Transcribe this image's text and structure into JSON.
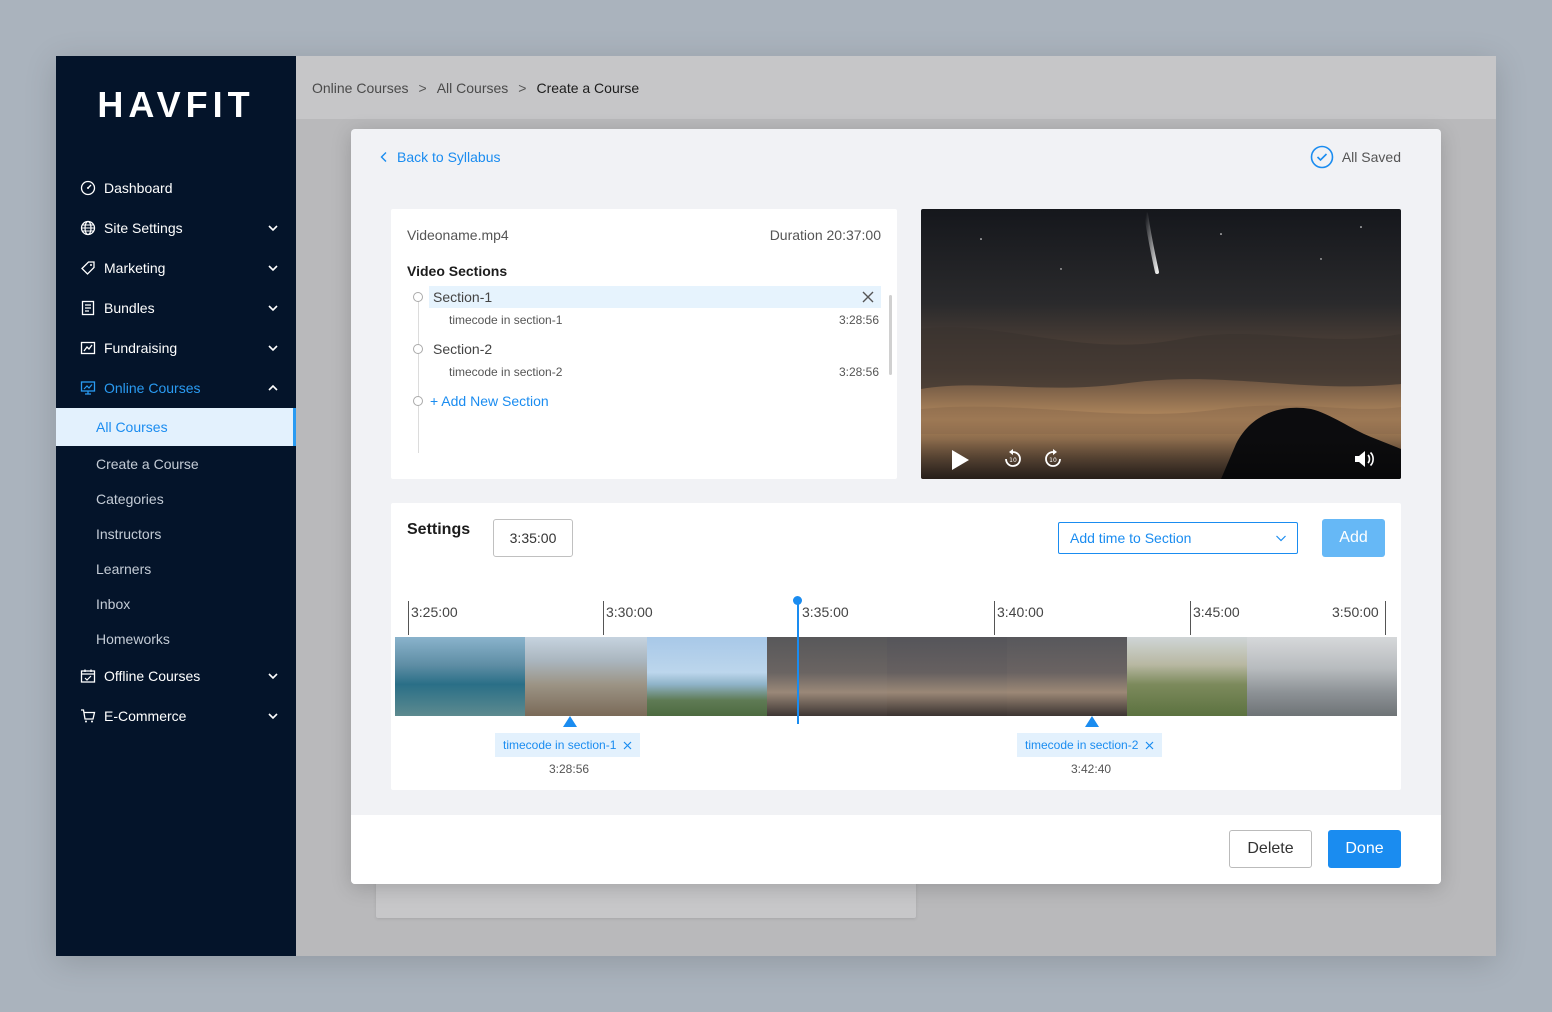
{
  "app": {
    "logo": "HAVFIT"
  },
  "sidebar": {
    "items": [
      {
        "label": "Dashboard",
        "icon": "dashboard-icon",
        "has_chevron": false
      },
      {
        "label": "Site Settings",
        "icon": "globe-icon",
        "has_chevron": true
      },
      {
        "label": "Marketing",
        "icon": "tag-icon",
        "has_chevron": true
      },
      {
        "label": "Bundles",
        "icon": "bundles-icon",
        "has_chevron": true
      },
      {
        "label": "Fundraising",
        "icon": "fundraising-icon",
        "has_chevron": true
      },
      {
        "label": "Online Courses",
        "icon": "presentation-icon",
        "has_chevron": true,
        "active": true
      }
    ],
    "online_courses_sub": [
      {
        "label": "All Courses",
        "selected": true
      },
      {
        "label": "Create a Course"
      },
      {
        "label": "Categories"
      },
      {
        "label": "Instructors"
      },
      {
        "label": "Learners"
      },
      {
        "label": "Inbox"
      },
      {
        "label": "Homeworks"
      }
    ],
    "items_after": [
      {
        "label": "Offline Courses",
        "icon": "calendar-icon",
        "has_chevron": true
      },
      {
        "label": "E-Commerce",
        "icon": "cart-icon",
        "has_chevron": true
      }
    ]
  },
  "breadcrumb": {
    "items": [
      "Online Courses",
      "All Courses",
      "Create a Course"
    ],
    "separator": ">"
  },
  "modal": {
    "back_label": "Back to Syllabus",
    "saved_label": "All Saved",
    "file": {
      "name": "Videoname.mp4",
      "duration": "Duration 20:37:00"
    },
    "video_sections_title": "Video Sections",
    "sections": [
      {
        "name": "Section-1",
        "timecode_label": "timecode in section-1",
        "timecode": "3:28:56"
      },
      {
        "name": "Section-2",
        "timecode_label": "timecode in section-2",
        "timecode": "3:28:56"
      }
    ],
    "add_section_label": "+ Add New Section",
    "settings": {
      "title": "Settings",
      "time_value": "3:35:00",
      "select_placeholder": "Add time to Section",
      "add_label": "Add"
    },
    "timeline": {
      "ticks": [
        "3:25:00",
        "3:30:00",
        "3:35:00",
        "3:40:00",
        "3:45:00",
        "3:50:00"
      ],
      "markers": [
        {
          "label": "timecode in section-1",
          "time": "3:28:56"
        },
        {
          "label": "timecode in section-2",
          "time": "3:42:40"
        }
      ]
    },
    "footer": {
      "delete_label": "Delete",
      "done_label": "Done"
    }
  },
  "colors": {
    "sidebar_bg": "#04142a",
    "accent": "#1a8cf0",
    "accent_light": "#e3f1fd",
    "add_button": "#66b8f6"
  }
}
